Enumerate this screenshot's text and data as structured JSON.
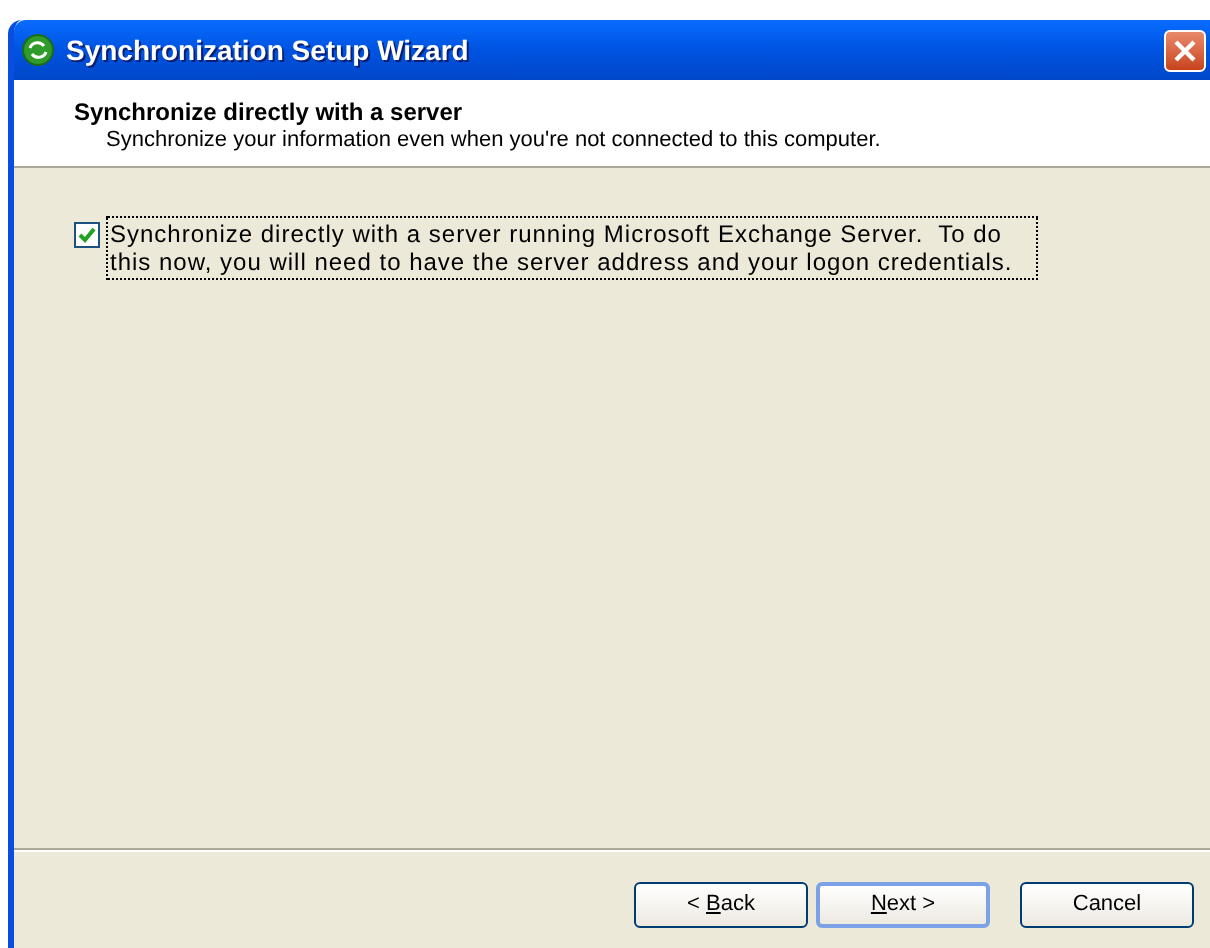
{
  "window": {
    "title": "Synchronization Setup Wizard"
  },
  "header": {
    "title": "Synchronize directly with a server",
    "subtitle": "Synchronize your information even when you're not connected to this computer."
  },
  "option": {
    "label": "Synchronize directly with a server running Microsoft Exchange Server.  To do this now, you will need to have the server address and your logon credentials.",
    "checked": true,
    "focused": true
  },
  "buttons": [
    {
      "before": "< ",
      "access_key": "B",
      "after": "ack",
      "default": false
    },
    {
      "access_key": "N",
      "after": "ext >",
      "default": true
    },
    {
      "before": "Cancel",
      "default": false
    }
  ]
}
